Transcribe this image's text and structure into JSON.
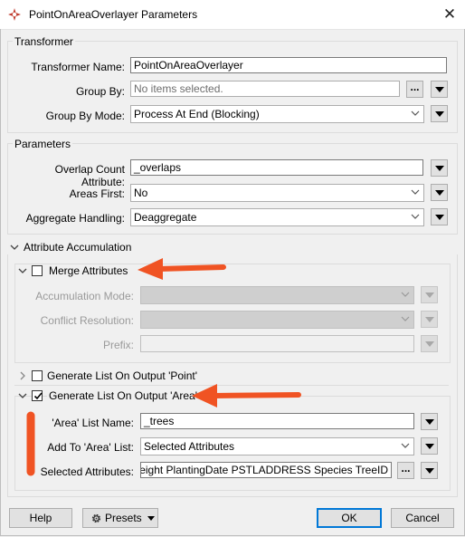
{
  "window": {
    "title": "PointOnAreaOverlayer Parameters",
    "close_glyph": "✕"
  },
  "transformer": {
    "legend": "Transformer",
    "name_label": "Transformer Name:",
    "name_value": "PointOnAreaOverlayer",
    "group_by_label": "Group By:",
    "group_by_placeholder": "No items selected.",
    "group_by_mode_label": "Group By Mode:",
    "group_by_mode_value": "Process At End (Blocking)"
  },
  "parameters": {
    "legend": "Parameters",
    "overlap_label": "Overlap Count Attribute:",
    "overlap_value": "_overlaps",
    "areas_first_label": "Areas First:",
    "areas_first_value": "No",
    "aggregate_label": "Aggregate Handling:",
    "aggregate_value": "Deaggregate"
  },
  "accumulation": {
    "legend": "Attribute Accumulation",
    "merge": {
      "label": "Merge Attributes",
      "checked": false,
      "mode_label": "Accumulation Mode:",
      "conflict_label": "Conflict Resolution:",
      "prefix_label": "Prefix:"
    },
    "list_point": {
      "label": "Generate List On Output 'Point'",
      "checked": false
    },
    "list_area": {
      "label": "Generate List On Output 'Area'",
      "checked": true,
      "list_name_label": "'Area' List Name:",
      "list_name_value": "_trees",
      "add_to_label": "Add To 'Area' List:",
      "add_to_value": "Selected Attributes",
      "selected_label": "Selected Attributes:",
      "selected_value": "Genus Height PlantingDate PSTLADDRESS Species TreeID"
    }
  },
  "footer": {
    "help": "Help",
    "presets": "Presets",
    "ok": "OK",
    "cancel": "Cancel"
  },
  "ellipsis_label": "...",
  "colors": {
    "annotation_arrow": "#f05323",
    "default_button_border": "#0078d7",
    "window_background": "#f0f0f0"
  }
}
